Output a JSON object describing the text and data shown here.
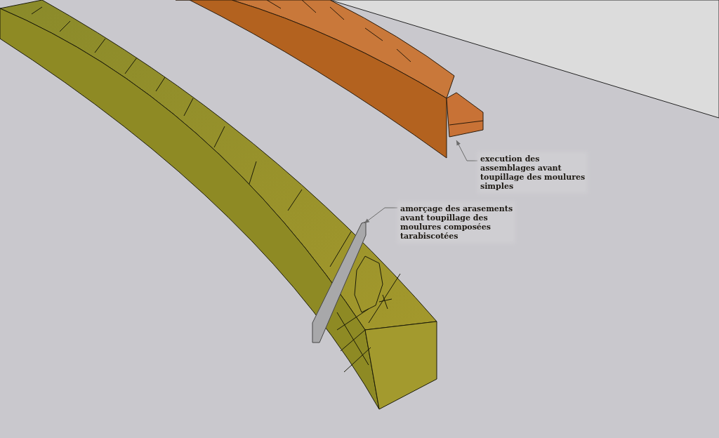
{
  "viewport": {
    "annotations": [
      {
        "kind": "upper",
        "lines": [
          "execution des",
          "assemblages avant",
          "toupillage des moulures",
          "simples"
        ]
      },
      {
        "kind": "lower",
        "lines": [
          "amorçage des arasements",
          "avant toupillage des",
          "moulures composées",
          "tarabiscotées"
        ]
      }
    ]
  }
}
